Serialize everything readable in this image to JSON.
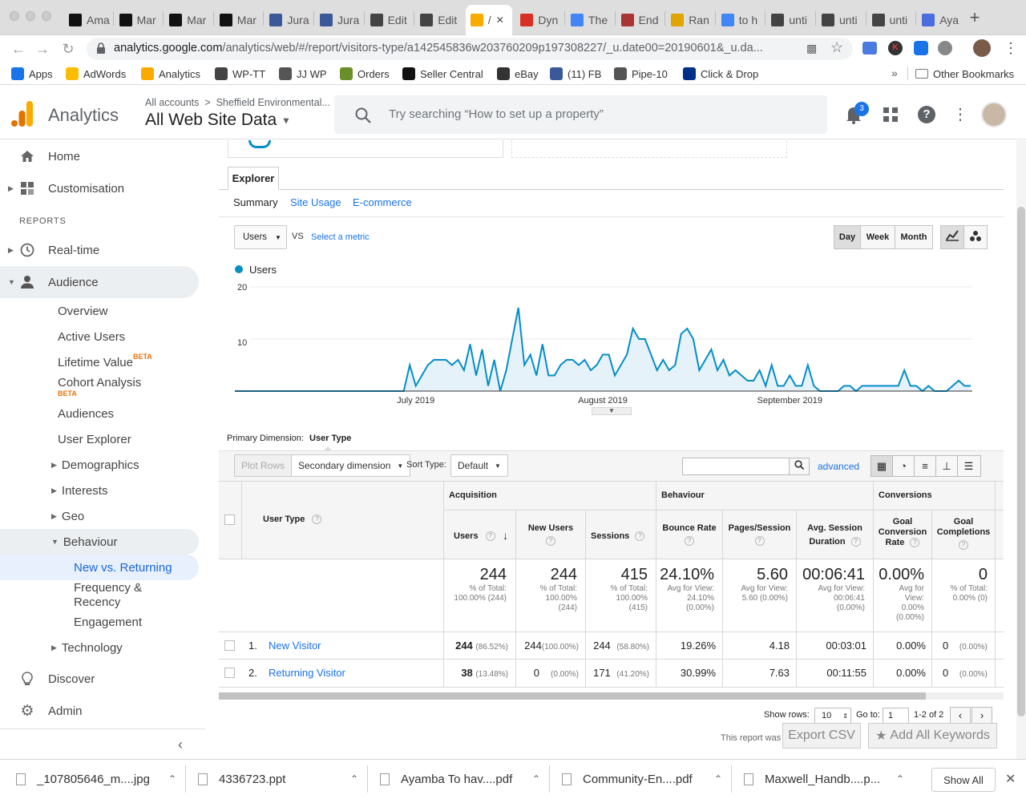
{
  "browser": {
    "tabs": [
      {
        "label": "Ama",
        "icon": "amazon-icon",
        "color": "#111111"
      },
      {
        "label": "Mar",
        "icon": "amazon-icon",
        "color": "#111111"
      },
      {
        "label": "Mar",
        "icon": "amazon-icon",
        "color": "#111111"
      },
      {
        "label": "Mar",
        "icon": "amazon-icon",
        "color": "#111111"
      },
      {
        "label": "Jura",
        "icon": "facebook-icon",
        "color": "#3b5998"
      },
      {
        "label": "Jura",
        "icon": "facebook-icon",
        "color": "#3b5998"
      },
      {
        "label": "Edit",
        "icon": "wordpress-icon",
        "color": "#444444"
      },
      {
        "label": "Edit",
        "icon": "wordpress-icon",
        "color": "#444444"
      },
      {
        "label": "/",
        "icon": "analytics-icon",
        "color": "#f9ab00"
      },
      {
        "label": "Dyn",
        "icon": "info-icon",
        "color": "#d93025"
      },
      {
        "label": "The",
        "icon": "google-icon",
        "color": "#4285f4"
      },
      {
        "label": "End",
        "icon": "slides-icon",
        "color": "#a33"
      },
      {
        "label": "Ran",
        "icon": "byp-icon",
        "color": "#e0a500"
      },
      {
        "label": "to h",
        "icon": "google-icon",
        "color": "#4285f4"
      },
      {
        "label": "unti",
        "icon": "wordpress-icon",
        "color": "#444444"
      },
      {
        "label": "unti",
        "icon": "wordpress-icon",
        "color": "#444444"
      },
      {
        "label": "unti",
        "icon": "wordpress-icon",
        "color": "#444444"
      },
      {
        "label": "Aya",
        "icon": "doc-icon",
        "color": "#4a6ee0"
      }
    ],
    "url_host": "analytics.google.com",
    "url_path": "/analytics/web/#/report/visitors-type/a142545836w203760209p197308227/_u.date00=20190601&_u.da...",
    "bookmarks": [
      {
        "label": "Apps",
        "icon": "apps-grid-icon"
      },
      {
        "label": "AdWords",
        "icon": "adwords-icon"
      },
      {
        "label": "Analytics",
        "icon": "analytics-icon"
      },
      {
        "label": "WP-TT",
        "icon": "tt-icon"
      },
      {
        "label": "JJ WP",
        "icon": "wordpress-icon"
      },
      {
        "label": "Orders",
        "icon": "gear-icon"
      },
      {
        "label": "Seller Central",
        "icon": "amazon-icon"
      },
      {
        "label": "eBay",
        "icon": "ebay-icon"
      },
      {
        "label": "(11) FB",
        "icon": "facebook-icon"
      },
      {
        "label": "Pipe-10",
        "icon": "wordpress-icon"
      },
      {
        "label": "Click & Drop",
        "icon": "paypal-icon"
      }
    ],
    "other_bookmarks": "Other Bookmarks"
  },
  "ga_header": {
    "product": "Analytics",
    "breadcrumb": "All accounts  >  Sheffield Environmental...",
    "view_name": "All Web Site Data",
    "search_placeholder": "Try searching “How to set up a property”",
    "notifications_count": "3"
  },
  "sidebar": {
    "home": "Home",
    "customisation": "Customisation",
    "reports_heading": "REPORTS",
    "realtime": "Real-time",
    "audience": "Audience",
    "overview": "Overview",
    "active_users": "Active Users",
    "lifetime_value": "Lifetime Value",
    "cohort_analysis": "Cohort Analysis",
    "beta": "BETA",
    "audiences": "Audiences",
    "user_explorer": "User Explorer",
    "demographics": "Demographics",
    "interests": "Interests",
    "geo": "Geo",
    "behaviour": "Behaviour",
    "new_vs_returning": "New vs. Returning",
    "frequency_1": "Frequency &",
    "frequency_2": "Recency",
    "engagement": "Engagement",
    "technology": "Technology",
    "discover": "Discover",
    "admin": "Admin"
  },
  "explorer": {
    "tab": "Explorer",
    "subtabs": [
      "Summary",
      "Site Usage",
      "E-commerce"
    ],
    "metric": "Users",
    "vs": "VS",
    "select_metric": "Select a metric",
    "granularity": [
      "Day",
      "Week",
      "Month"
    ],
    "legend": "Users"
  },
  "chart_data": {
    "type": "area",
    "series": [
      {
        "name": "Users",
        "color": "#058dc7"
      }
    ],
    "ylim": [
      0,
      20
    ],
    "yticks": [
      10,
      20
    ],
    "xtick_labels": [
      "July 2019",
      "August 2019",
      "September 2019"
    ],
    "x_start": "2019-06-01",
    "values": [
      0,
      0,
      0,
      0,
      0,
      0,
      0,
      0,
      0,
      0,
      0,
      0,
      0,
      0,
      0,
      0,
      0,
      0,
      0,
      0,
      0,
      0,
      0,
      0,
      0,
      0,
      0,
      0,
      0,
      5,
      1,
      3,
      5,
      6,
      6,
      6,
      5,
      6,
      4,
      9,
      3,
      8,
      1,
      6,
      0,
      4,
      10,
      16,
      5,
      7,
      3,
      9,
      3,
      3,
      5,
      6,
      6,
      5,
      6,
      4,
      5,
      7,
      7,
      3,
      5,
      7,
      12,
      10,
      10,
      7,
      4,
      6,
      4,
      5,
      11,
      12,
      10,
      4,
      6,
      8,
      4,
      6,
      3,
      4,
      3,
      2,
      2,
      4,
      1,
      5,
      1,
      1,
      3,
      1,
      1,
      5,
      1,
      0,
      0,
      0,
      0,
      1,
      1,
      0,
      1,
      1,
      1,
      1,
      1,
      1,
      1,
      4,
      1,
      1,
      0,
      1,
      0,
      0,
      0,
      1,
      2,
      1,
      1
    ]
  },
  "table": {
    "primary_dimension_label": "Primary Dimension:",
    "primary_dimension_value": "User Type",
    "plot_rows": "Plot Rows",
    "secondary_dimension": "Secondary dimension",
    "sort_type_label": "Sort Type:",
    "sort_type_value": "Default",
    "advanced": "advanced",
    "group_acquisition": "Acquisition",
    "group_behaviour": "Behaviour",
    "group_conversions": "Conversions",
    "col_user_type": "User Type",
    "col_users": "Users",
    "col_new_users": "New Users",
    "col_sessions": "Sessions",
    "col_bounce_rate": "Bounce Rate",
    "col_pages_session": "Pages/Session",
    "col_avg_session_1": "Avg. Session",
    "col_avg_session_2": "Duration",
    "col_goal_conv_1": "Goal",
    "col_goal_conv_2": "Conversion",
    "col_goal_conv_3": "Rate",
    "col_goal_comp_1": "Goal",
    "col_goal_comp_2": "Completions",
    "totals": {
      "users": "244",
      "users_sub": "% of Total:\n100.00% (244)",
      "new_users": "244",
      "new_users_sub": "% of Total:\n100.00%\n(244)",
      "sessions": "415",
      "sessions_sub": "% of Total:\n100.00%\n(415)",
      "bounce": "24.10%",
      "bounce_sub": "Avg for View:\n24.10%\n(0.00%)",
      "pages": "5.60",
      "pages_sub": "Avg for View:\n5.60 (0.00%)",
      "duration": "00:06:41",
      "duration_sub": "Avg for View:\n00:06:41\n(0.00%)",
      "conv": "0.00%",
      "conv_sub": "Avg for\nView:\n0.00%\n(0.00%)",
      "comp": "0",
      "comp_sub": "% of Total:\n0.00% (0)"
    },
    "rows": [
      {
        "num": "1.",
        "type": "New Visitor",
        "users": "244",
        "users_pct": "(86.52%)",
        "new_users": "244",
        "new_users_pct": "(100.00%)",
        "sessions": "244",
        "sessions_pct": "(58.80%)",
        "bounce": "19.26%",
        "pages": "4.18",
        "duration": "00:03:01",
        "conv": "0.00%",
        "comp": "0",
        "comp_pct": "(0.00%)"
      },
      {
        "num": "2.",
        "type": "Returning Visitor",
        "users": "38",
        "users_pct": "(13.48%)",
        "new_users": "0",
        "new_users_pct": "(0.00%)",
        "sessions": "171",
        "sessions_pct": "(41.20%)",
        "bounce": "30.99%",
        "pages": "7.63",
        "duration": "00:11:55",
        "conv": "0.00%",
        "comp": "0",
        "comp_pct": "(0.00%)"
      }
    ],
    "show_rows_label": "Show rows:",
    "show_rows_value": "10",
    "goto_label": "Go to:",
    "goto_value": "1",
    "range": "1-2 of 2",
    "report_note": "This report was",
    "export_csv": "Export CSV",
    "add_keywords": "Add All Keywords"
  },
  "downloads": {
    "items": [
      "_107805646_m....jpg",
      "4336723.ppt",
      "Ayamba To hav....pdf",
      "Community-En....pdf",
      "Maxwell_Handb....p..."
    ],
    "show_all": "Show All"
  }
}
